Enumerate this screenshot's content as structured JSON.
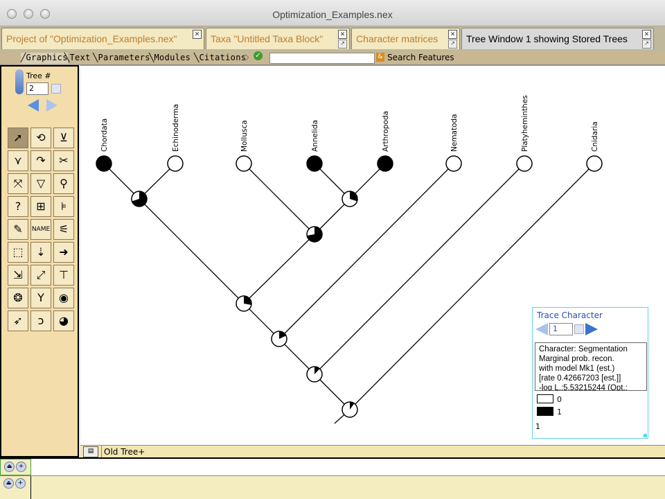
{
  "window": {
    "title": "Optimization_Examples.nex"
  },
  "tabs": [
    {
      "label": "Project of \"Optimization_Examples.nex\"",
      "active": false
    },
    {
      "label": "Taxa \"Untitled Taxa Block\"",
      "active": false
    },
    {
      "label": "Character matrices",
      "active": false
    },
    {
      "label": "Tree Window 1 showing Stored Trees",
      "active": true
    }
  ],
  "subtabs": [
    {
      "label": "Graphics",
      "active": true
    },
    {
      "label": "Text",
      "active": false
    },
    {
      "label": "Parameters",
      "active": false
    },
    {
      "label": "Modules",
      "active": false
    },
    {
      "label": "Citations",
      "active": false
    }
  ],
  "search": {
    "value": "",
    "button_label": "Search Features"
  },
  "tree_nav": {
    "label": "Tree #",
    "value": "2"
  },
  "tree": {
    "taxa": [
      "Chordata",
      "Echinoderma",
      "Mollusca",
      "Annelida",
      "Arthropoda",
      "Nematoda",
      "Platyheminthes",
      "Cnidaria"
    ],
    "tip_states": [
      1,
      0,
      0,
      1,
      1,
      0,
      0,
      0
    ],
    "internal_state1_fraction": [
      0.7,
      0.3,
      0.72,
      0.28,
      0.18,
      0.12,
      0.1,
      0.1
    ]
  },
  "trace_character": {
    "title": "Trace Character",
    "value": "1",
    "description": "Character: Segmentation\nMarginal prob. recon.\nwith model Mk1 (est.)\n[rate 0.42667203 [est.]]\n-log L.:5.53215244 (Opt.:",
    "legend": [
      {
        "label": "0",
        "color": "#ffffff"
      },
      {
        "label": "1",
        "color": "#000000"
      }
    ],
    "footer": "1"
  },
  "statusbar": {
    "label": "Old Tree+"
  },
  "colors": {
    "tab_text": "#c07d2c",
    "tool_panel": "#f2ddab",
    "trace_title": "#2a4fb5",
    "trace_border": "#60d3e6"
  }
}
